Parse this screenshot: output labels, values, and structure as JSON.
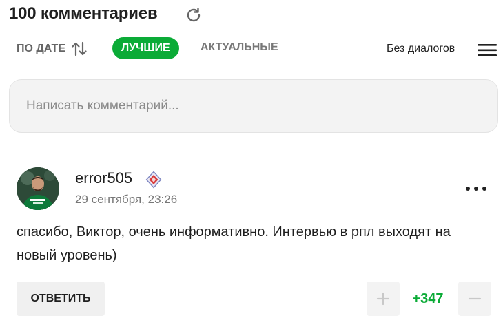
{
  "header": {
    "title": "100 комментариев"
  },
  "sort": {
    "by_date_label": "ПО ДАТЕ",
    "best_label": "ЛУЧШИЕ",
    "actual_label": "АКТУАЛЬНЫЕ",
    "no_dialogs_label": "Без диалогов"
  },
  "composer": {
    "placeholder": "Написать комментарий..."
  },
  "comment": {
    "username": "error505",
    "timestamp": "29 сентября, 23:26",
    "text": "спасибо, Виктор, очень информативно. Интервью в рпл выходят на новый уровень)",
    "reply_label": "ОТВЕТИТЬ",
    "score": "+347"
  },
  "icons": {
    "refresh": "refresh-icon",
    "sort": "sort-arrows-icon",
    "menu": "hamburger-menu-icon",
    "badge": "club-badge-icon",
    "more": "more-dots-icon",
    "plus": "plus-icon",
    "minus": "minus-icon"
  },
  "colors": {
    "accent": "#0bab37",
    "muted": "#777777",
    "input_bg": "#f3f3f3"
  }
}
